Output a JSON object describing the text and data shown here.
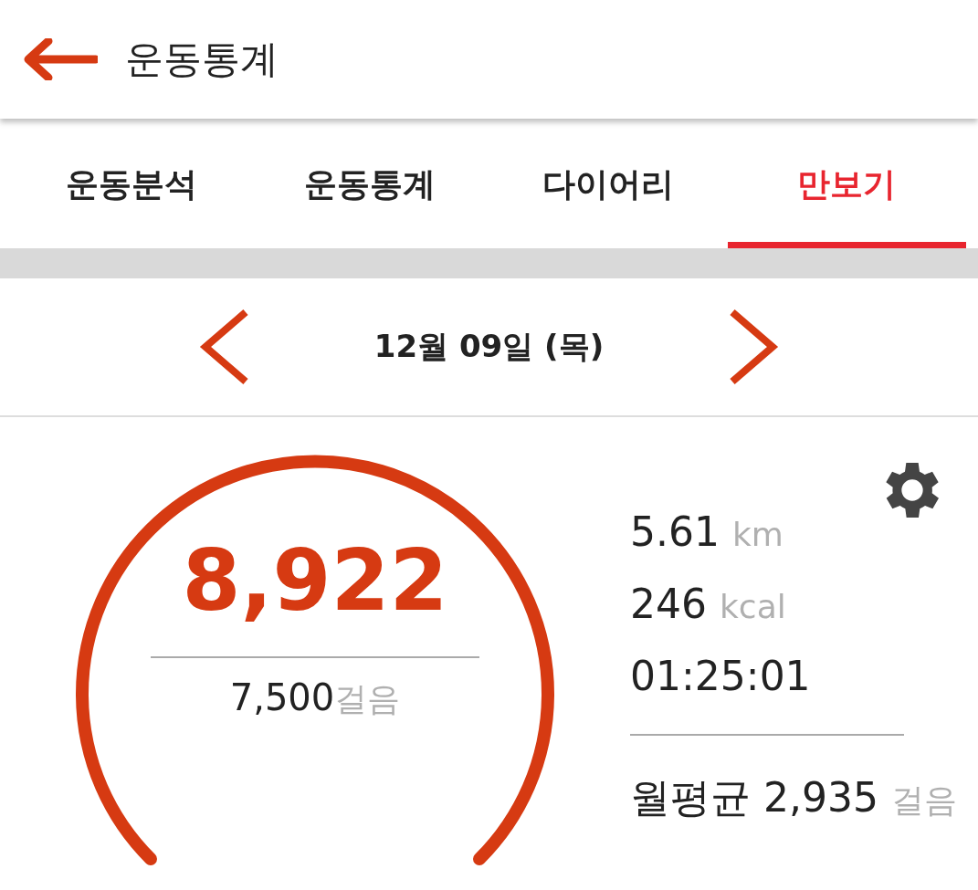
{
  "header": {
    "title": "운동통계"
  },
  "tabs": [
    {
      "label": "운동분석",
      "selected": false
    },
    {
      "label": "운동통계",
      "selected": false
    },
    {
      "label": "다이어리",
      "selected": false
    },
    {
      "label": "만보기",
      "selected": true
    }
  ],
  "date": "12월 09일 (목)",
  "pedometer": {
    "steps": "8,922",
    "goal": "7,500",
    "goal_unit": "걸음",
    "stats": [
      {
        "value": "5.61",
        "unit": "km"
      },
      {
        "value": "246",
        "unit": "kcal"
      },
      {
        "value": "01:25:01"
      }
    ],
    "monthly": {
      "label": "월평균",
      "value": "2,935",
      "unit": "걸음"
    }
  }
}
